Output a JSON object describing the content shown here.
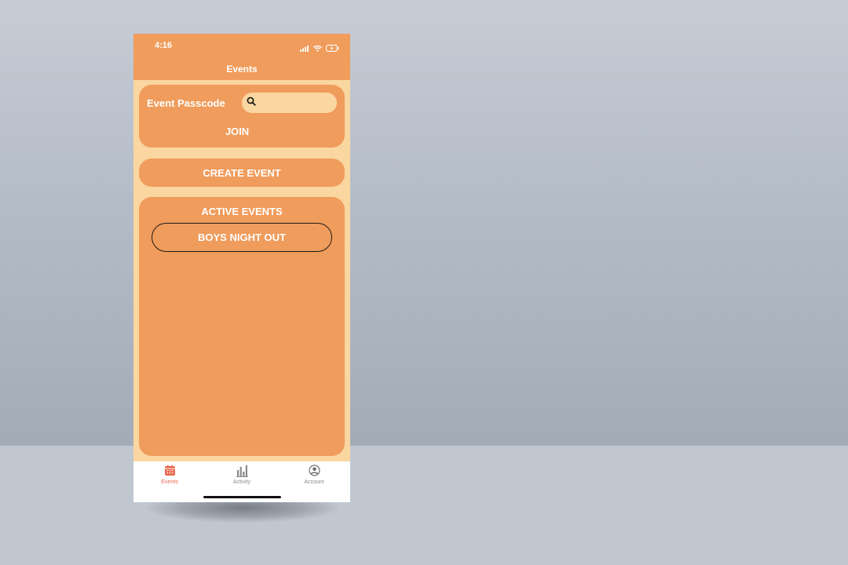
{
  "status_bar": {
    "time": "4:16"
  },
  "header": {
    "title": "Events"
  },
  "join_card": {
    "passcode_label": "Event Passcode",
    "passcode_value": "",
    "join_label": "JOIN"
  },
  "create_event": {
    "label": "CREATE EVENT"
  },
  "active_events": {
    "title": "ACTIVE EVENTS",
    "items": [
      {
        "label": "BOYS NIGHT OUT"
      }
    ]
  },
  "tab_bar": {
    "items": [
      {
        "label": "Events",
        "icon": "calendar-icon",
        "active": true
      },
      {
        "label": "Activity",
        "icon": "bar-chart-icon",
        "active": false
      },
      {
        "label": "Account",
        "icon": "account-icon",
        "active": false
      }
    ]
  },
  "colors": {
    "header": "#f09c5c",
    "card": "#f09c5c",
    "background": "#fad6a0",
    "tab_active": "#e8664a",
    "tab_inactive": "#8a8a8e"
  }
}
